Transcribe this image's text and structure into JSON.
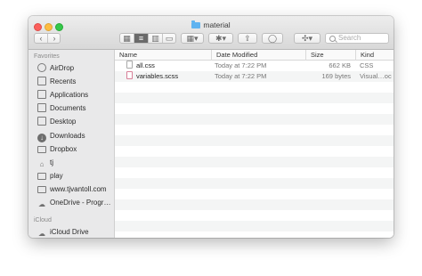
{
  "window": {
    "title": "material"
  },
  "toolbar": {
    "back": "‹",
    "forward": "›",
    "view_icon": "▦",
    "list_icon": "≡",
    "columns_icon": "▥",
    "gallery_icon": "▭",
    "group_icon": "▦▾",
    "action_icon": "✱▾",
    "share_icon": "⇪",
    "tag_icon": "◯",
    "dropbox_icon": "✣▾",
    "search_placeholder": "Search"
  },
  "sidebar": {
    "favorites_heading": "Favorites",
    "icloud_heading": "iCloud",
    "items": [
      {
        "label": "AirDrop",
        "icon": "airdrop-icon"
      },
      {
        "label": "Recents",
        "icon": "recents-icon"
      },
      {
        "label": "Applications",
        "icon": "applications-icon"
      },
      {
        "label": "Documents",
        "icon": "documents-icon"
      },
      {
        "label": "Desktop",
        "icon": "desktop-icon"
      },
      {
        "label": "Downloads",
        "icon": "downloads-icon"
      },
      {
        "label": "Dropbox",
        "icon": "dropbox-icon"
      },
      {
        "label": "tj",
        "icon": "home-icon"
      },
      {
        "label": "play",
        "icon": "folder-icon"
      },
      {
        "label": "www.tjvantoll.com",
        "icon": "folder-icon"
      },
      {
        "label": "OneDrive - Progr…",
        "icon": "cloud-icon"
      }
    ],
    "icloud_items": [
      {
        "label": "iCloud Drive",
        "icon": "cloud-icon"
      }
    ]
  },
  "columns": {
    "name": "Name",
    "date": "Date Modified",
    "size": "Size",
    "kind": "Kind"
  },
  "files": [
    {
      "name": "all.css",
      "date": "Today at 7:22 PM",
      "size": "662 KB",
      "kind": "CSS"
    },
    {
      "name": "variables.scss",
      "date": "Today at 7:22 PM",
      "size": "169 bytes",
      "kind": "Visual…oc"
    }
  ]
}
